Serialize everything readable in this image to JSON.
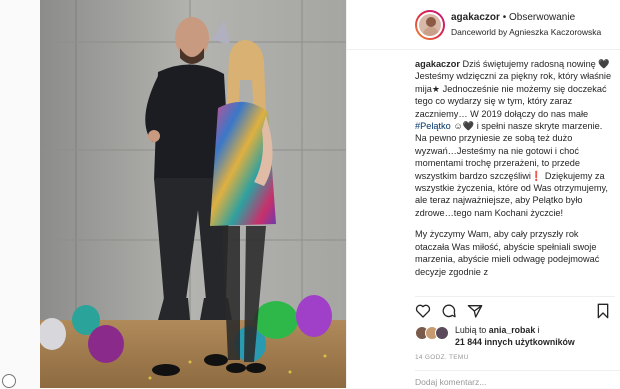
{
  "header": {
    "username": "agakaczor",
    "separator": "•",
    "follow_label": "Obserwowanie",
    "subtitle": "Danceworld by Agnieszka Kaczorowska"
  },
  "caption": {
    "username": "agakaczor",
    "para1_a": "Dziś świętujemy radosną nowinę ",
    "para1_b": " Jesteśmy wdzięczni za piękny rok, który właśnie mija",
    "para1_c": " Jednocześnie nie możemy się doczekać tego co wydarzy się w tym, który zaraz zaczniemy… W 2019 dołączy do nas małe ",
    "hashtag": "#Pelątko",
    "para1_d": " i spełni nasze skryte marzenie. Na pewno przyniesie ze sobą też dużo wyzwań…Jesteśmy na nie gotowi i choć momentami trochę przerażeni, to przede wszystkim bardzo szczęśliwi",
    "para1_e": " Dziękujemy za wszystkie życzenia, które od Was otrzymujemy, ale teraz najważniejsze, aby Pelątko było zdrowe…tego nam Kochani życzcie!",
    "para2": "My życzymy Wam, aby cały przyszły rok otaczała Was miłość, abyście spełniali swoje marzenia, abyście mieli odwagę podejmować decyzje zgodnie z"
  },
  "likes": {
    "prefix": "Lubią to",
    "user": "ania_robak",
    "middle": " i",
    "count": "21 844 innych użytkowników"
  },
  "timestamp": "14 GODZ. TEMU",
  "comment": {
    "placeholder": "Dodaj komentarz..."
  },
  "icons": {
    "like": "heart-icon",
    "comment": "comment-icon",
    "share": "share-icon",
    "save": "bookmark-icon"
  }
}
